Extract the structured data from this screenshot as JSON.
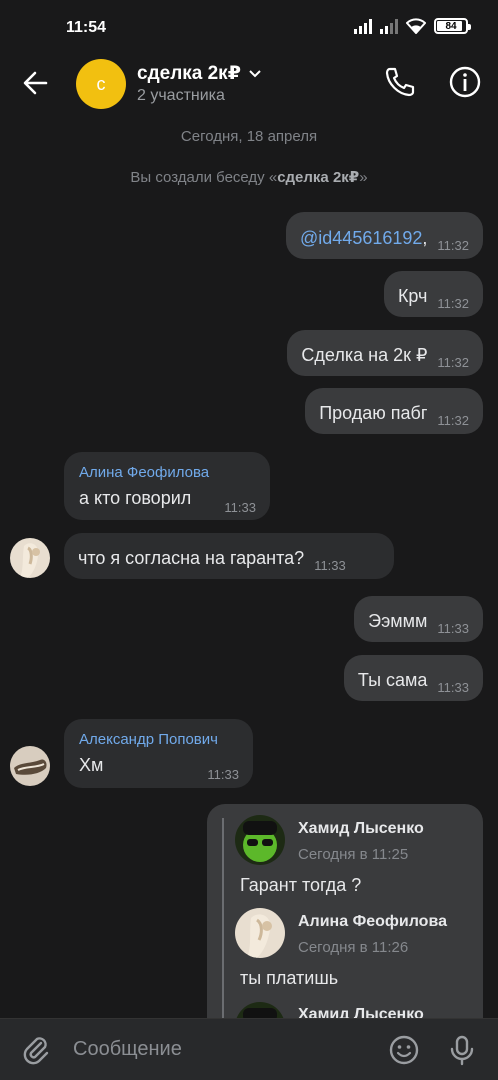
{
  "status": {
    "time": "11:54",
    "battery": "84"
  },
  "chat": {
    "avatar_letter": "с",
    "title": "сделка 2к₽",
    "subtitle": "2 участника"
  },
  "system": {
    "date": "Сегодня, 18 апреля",
    "created_prefix": "Вы создали беседу «",
    "created_name": "сделка 2к₽",
    "created_suffix": "»"
  },
  "messages": [
    {
      "text": "@id445616192",
      "suffix": ",",
      "time": "11:32"
    },
    {
      "text": "Крч",
      "time": "11:32"
    },
    {
      "text": "Сделка на 2к ₽",
      "time": "11:32"
    },
    {
      "text": "Продаю пабг",
      "time": "11:32"
    },
    {
      "sender": "Алина Феофилова",
      "text": "а кто говорил",
      "time": "11:33"
    },
    {
      "text": "что я согласна на гаранта?",
      "time": "11:33"
    },
    {
      "text": "Ээммм",
      "time": "11:33"
    },
    {
      "text": "Ты сама",
      "time": "11:33"
    },
    {
      "sender": "Александр Попович",
      "text": "Хм",
      "time": "11:33"
    }
  ],
  "forwarded": [
    {
      "name": "Хамид Лысенко",
      "date": "Сегодня в 11:25",
      "text": "Гарант тогда ?"
    },
    {
      "name": "Алина Феофилова",
      "date": "Сегодня в 11:26",
      "text": "ты платишь"
    },
    {
      "name": "Хамид Лысенко"
    }
  ],
  "composer": {
    "placeholder": "Сообщение"
  },
  "icons": {
    "back": "arrow-left-icon",
    "call": "phone-icon",
    "info": "info-icon",
    "attach": "paperclip-icon",
    "emoji": "smile-icon",
    "mic": "microphone-icon"
  },
  "colors": {
    "accent": "#71aaeb",
    "bubble_out": "#3a3b3d",
    "bubble_in": "#2c2d2f",
    "chat_avatar": "#f2c010"
  }
}
